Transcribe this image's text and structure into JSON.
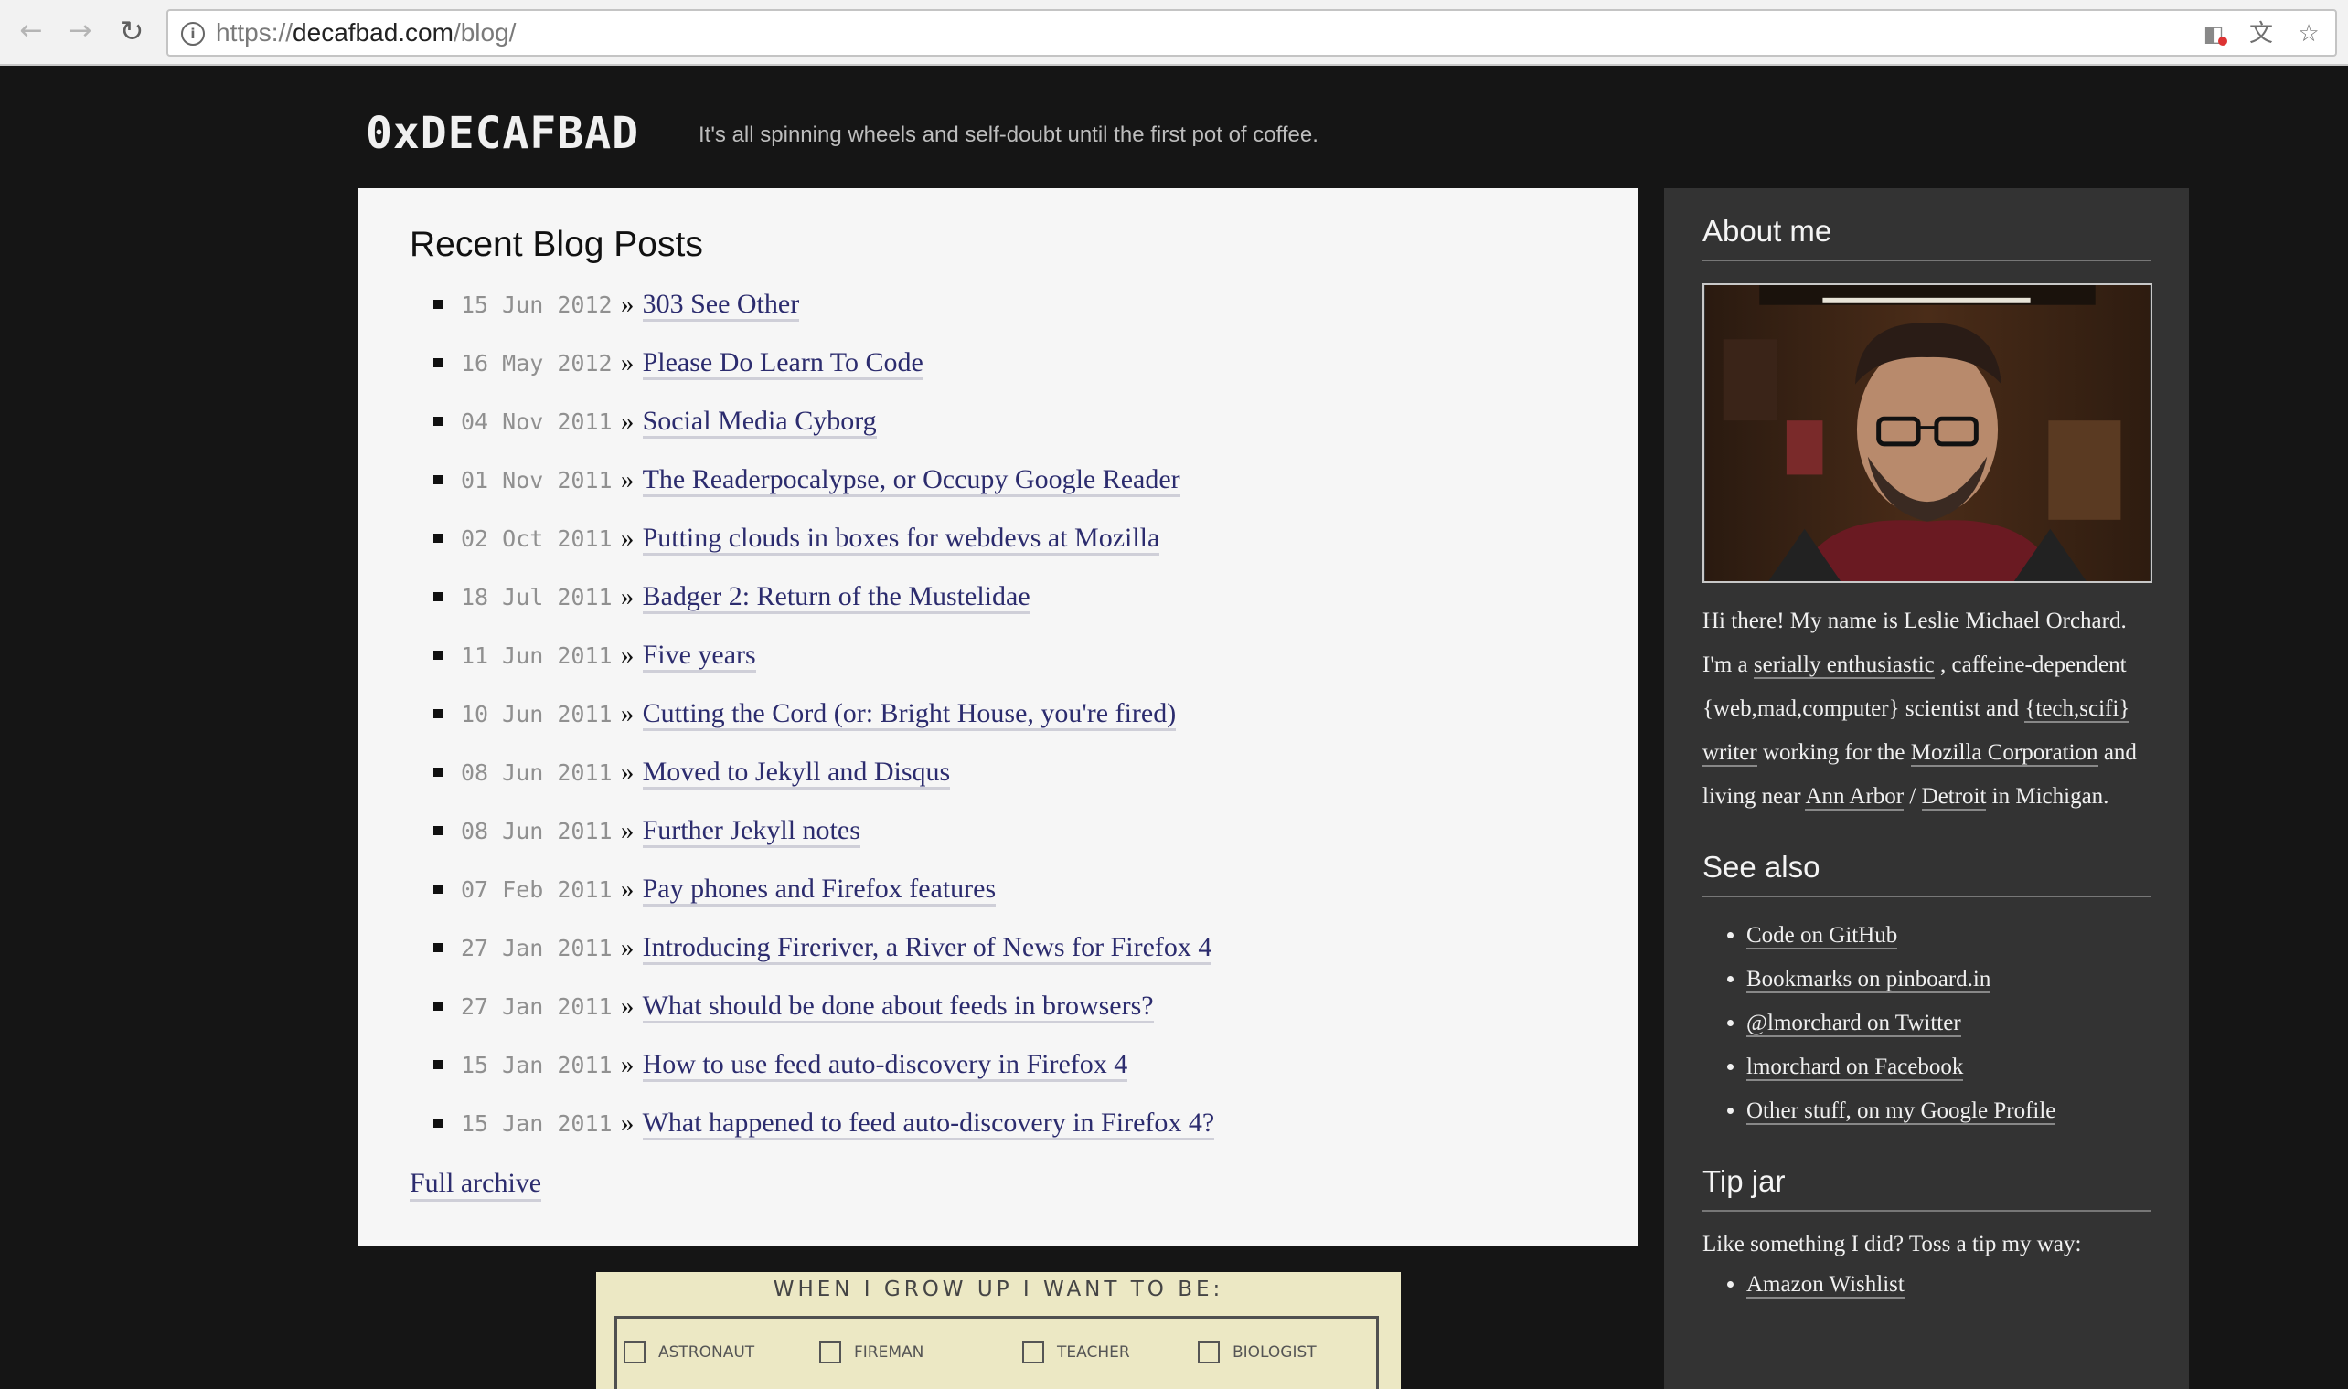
{
  "browser": {
    "back_icon": "back-arrow-icon",
    "forward_icon": "forward-arrow-icon",
    "reload_icon": "reload-icon",
    "url_prefix": "https://",
    "url_host": "decafbad.com",
    "url_path": "/blog/",
    "info_icon": "info-icon",
    "extensions": [
      "blocked-extension-icon",
      "translate-icon",
      "bookmark-star-icon"
    ]
  },
  "site": {
    "title": "0xDECAFBAD",
    "tagline": "It's all spinning wheels and self-doubt until the first pot of coffee."
  },
  "main": {
    "heading": "Recent Blog Posts",
    "separator": "»",
    "posts": [
      {
        "date": "15 Jun 2012",
        "title": "303 See Other"
      },
      {
        "date": "16 May 2012",
        "title": "Please Do Learn To Code"
      },
      {
        "date": "04 Nov 2011",
        "title": "Social Media Cyborg"
      },
      {
        "date": "01 Nov 2011",
        "title": "The Readerpocalypse, or Occupy Google Reader"
      },
      {
        "date": "02 Oct 2011",
        "title": "Putting clouds in boxes for webdevs at Mozilla"
      },
      {
        "date": "18 Jul 2011",
        "title": "Badger 2: Return of the Mustelidae"
      },
      {
        "date": "11 Jun 2011",
        "title": "Five years"
      },
      {
        "date": "10 Jun 2011",
        "title": "Cutting the Cord (or: Bright House, you're fired)"
      },
      {
        "date": "08 Jun 2011",
        "title": "Moved to Jekyll and Disqus"
      },
      {
        "date": "08 Jun 2011",
        "title": "Further Jekyll notes"
      },
      {
        "date": "07 Feb 2011",
        "title": "Pay phones and Firefox features"
      },
      {
        "date": "27 Jan 2011",
        "title": "Introducing Fireriver, a River of News for Firefox 4"
      },
      {
        "date": "27 Jan 2011",
        "title": "What should be done about feeds in browsers?"
      },
      {
        "date": "15 Jan 2011",
        "title": "How to use feed auto-discovery in Firefox 4"
      },
      {
        "date": "15 Jan 2011",
        "title": "What happened to feed auto-discovery in Firefox 4?"
      }
    ],
    "archive_label": "Full archive"
  },
  "bottom_image": {
    "heading": "WHEN I GROW UP I WANT TO BE:",
    "options": [
      "ASTRONAUT",
      "FIREMAN",
      "TEACHER",
      "BIOLOGIST"
    ]
  },
  "sidebar": {
    "about_heading": "About me",
    "bio": {
      "p1": "Hi there! My name is Leslie Michael Orchard. I'm a ",
      "link1": "serially enthusiastic",
      "p2": " , caffeine-dependent {web,mad,computer} scientist and ",
      "link2": "{tech,scifi} writer",
      "p3": " working for the ",
      "link3": "Mozilla Corporation",
      "p4": " and living near ",
      "link4": "Ann Arbor",
      "p5": " / ",
      "link5": "Detroit",
      "p6": " in Michigan."
    },
    "see_also_heading": "See also",
    "see_also": [
      "Code on GitHub",
      "Bookmarks on pinboard.in",
      "@lmorchard on Twitter",
      "lmorchard on Facebook",
      "Other stuff, on my Google Profile"
    ],
    "tip_heading": "Tip jar",
    "tip_text": "Like something I did? Toss a tip my way:",
    "tip_links": [
      "Amazon Wishlist"
    ]
  }
}
